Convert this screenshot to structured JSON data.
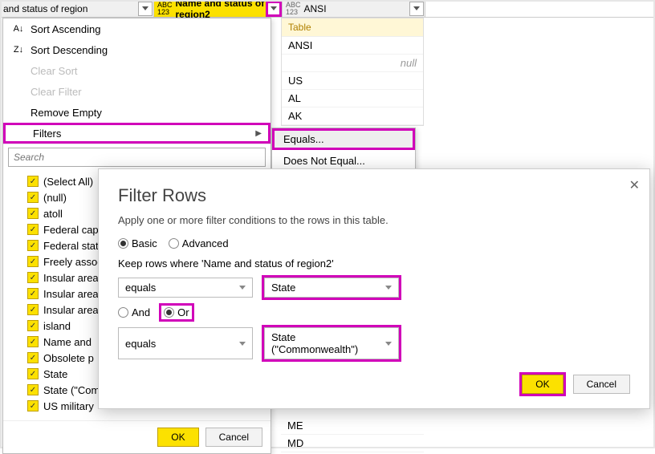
{
  "columns": {
    "col1": {
      "name": "and status of region",
      "type": "ABC123"
    },
    "col2": {
      "name": "Name and status of region2",
      "type": "ABC123"
    },
    "col3": {
      "name": "ANSI",
      "type": "ABC123"
    }
  },
  "filter_menu": {
    "sort_asc": "Sort Ascending",
    "sort_desc": "Sort Descending",
    "clear_sort": "Clear Sort",
    "clear_filter": "Clear Filter",
    "remove_empty": "Remove Empty",
    "filters": "Filters",
    "search_placeholder": "Search",
    "items": [
      "(Select All)",
      "(null)",
      "atoll",
      "Federal capital",
      "Federal state",
      "Freely associated",
      "Insular area (Co",
      "Insular area (Te",
      "Insular area",
      "island",
      "Name and",
      "Obsolete p",
      "State",
      "State (\"Commonwealth",
      "US military"
    ],
    "ok": "OK",
    "cancel": "Cancel"
  },
  "submenu": {
    "equals": "Equals...",
    "not_equals": "Does Not Equal..."
  },
  "value_list": {
    "header": "Table",
    "rows": [
      "ANSI",
      "null",
      "US",
      "AL",
      "AK"
    ],
    "bottom": [
      "ME",
      "MD"
    ]
  },
  "dialog": {
    "title": "Filter Rows",
    "desc": "Apply one or more filter conditions to the rows in this table.",
    "basic": "Basic",
    "advanced": "Advanced",
    "keep": "Keep rows where 'Name and status of region2'",
    "op1": "equals",
    "val1": "State",
    "and": "And",
    "or": "Or",
    "op2": "equals",
    "val2": "State (\"Commonwealth\")",
    "ok": "OK",
    "cancel": "Cancel"
  }
}
